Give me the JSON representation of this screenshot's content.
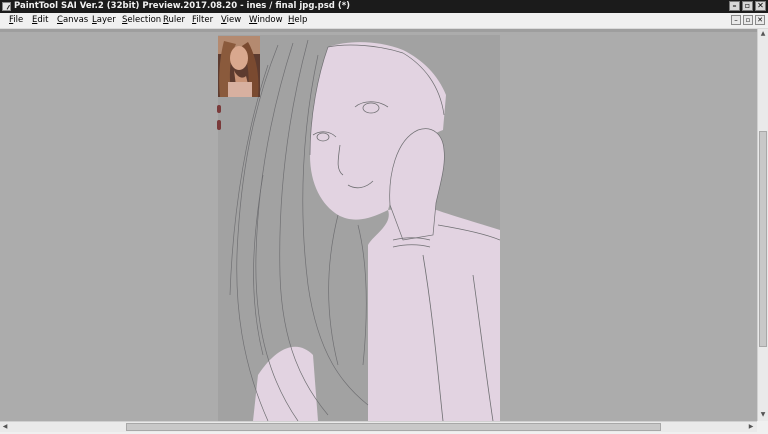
{
  "titlebar": {
    "title": "PaintTool SAI Ver.2 (32bit) Preview.2017.08.20 - ines / final jpg.psd (*)",
    "minimize": "–",
    "restore": "▫",
    "close": "✕"
  },
  "menubar": {
    "items": [
      "File",
      "Edit",
      "Canvas",
      "Layer",
      "Selection",
      "Ruler",
      "Filter",
      "View",
      "Window",
      "Help"
    ],
    "doc_minimize": "–",
    "doc_restore": "▫",
    "doc_close": "✕"
  },
  "scrollbars": {
    "up_arrow": "▲",
    "down_arrow": "▼",
    "left_arrow": "◀",
    "right_arrow": "▶"
  },
  "colors": {
    "workspace": "#acacac",
    "canvas_bg": "#a2a2a2",
    "skin": "#e2d3e1",
    "lineart": "#6f6f72"
  }
}
